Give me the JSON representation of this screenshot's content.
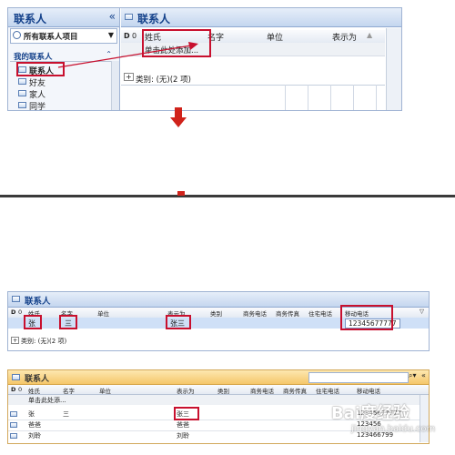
{
  "top": {
    "nav": {
      "title": "联系人",
      "collapse_glyph": "«",
      "all_items": "所有联系人项目",
      "my_contacts": "我的联系人",
      "folders": [
        "联系人",
        "好友",
        "家人",
        "同学"
      ]
    },
    "main": {
      "title": "联系人",
      "col_label_surname": "姓氏",
      "col_label_given": "名字",
      "col_label_company": "单位",
      "col_label_displayas": "表示为",
      "add_row": "单击此处添加...",
      "group_row": "类别: (无)(2 项)"
    }
  },
  "middle": {
    "title": "联系人",
    "columns": [
      "姓氏",
      "名字",
      "单位",
      "表示为",
      "类别",
      "商务电话",
      "商务传真",
      "住宅电话",
      "移动电话"
    ],
    "row": {
      "surname": "张",
      "given": "三",
      "displayas": "张三",
      "mobile": "12345677777"
    },
    "group_row": "类别: (无)(2 项)"
  },
  "bottom": {
    "title": "联系人",
    "columns": [
      "姓氏",
      "名字",
      "单位",
      "表示为",
      "类别",
      "商务电话",
      "商务传真",
      "住宅电话",
      "移动电话"
    ],
    "add_row": "单击此处添...",
    "rows": [
      {
        "surname": "张",
        "given": "三",
        "displayas": "张三",
        "mobile": "12345677777"
      },
      {
        "surname": "爸爸",
        "given": "",
        "displayas": "爸爸",
        "mobile": "123456"
      },
      {
        "surname": "刘聆",
        "given": "",
        "displayas": "刘聆",
        "mobile": "123466799"
      }
    ]
  },
  "watermark": {
    "text": "Bai度经验",
    "url": "jingyan.baidu.com"
  },
  "colors": {
    "accent_red": "#c8102e",
    "header_blue": "#15428b",
    "header_orange": "#f5c76a"
  }
}
